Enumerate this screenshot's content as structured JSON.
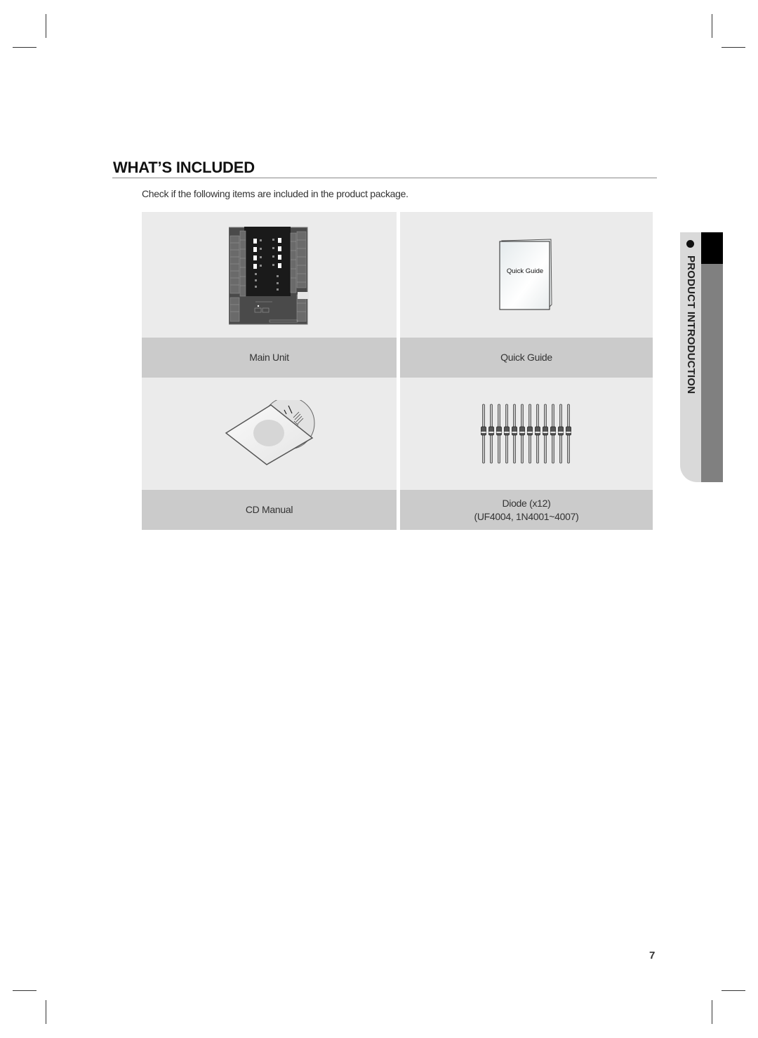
{
  "section": {
    "title": "WHAT’S INCLUDED",
    "intro": "Check if the following items are included in the product package."
  },
  "items": [
    {
      "name": "main-unit",
      "label": "Main Unit",
      "image_label": ""
    },
    {
      "name": "quick-guide",
      "label": "Quick Guide",
      "image_label": "Quick Guide"
    },
    {
      "name": "cd-manual",
      "label": "CD Manual",
      "image_label": ""
    },
    {
      "name": "diode",
      "label": "Diode (x12)",
      "sublabel": "(UF4004, 1N4001~4007)",
      "quantity": 12
    }
  ],
  "side_tab": {
    "label": "PRODUCT INTRODUCTION"
  },
  "page_number": "7",
  "colors": {
    "cell_bg": "#ebebeb",
    "band_bg": "#cbcbcb",
    "tab_light": "#d9d9d9",
    "tab_dark": "#808080",
    "tab_black": "#000000"
  }
}
